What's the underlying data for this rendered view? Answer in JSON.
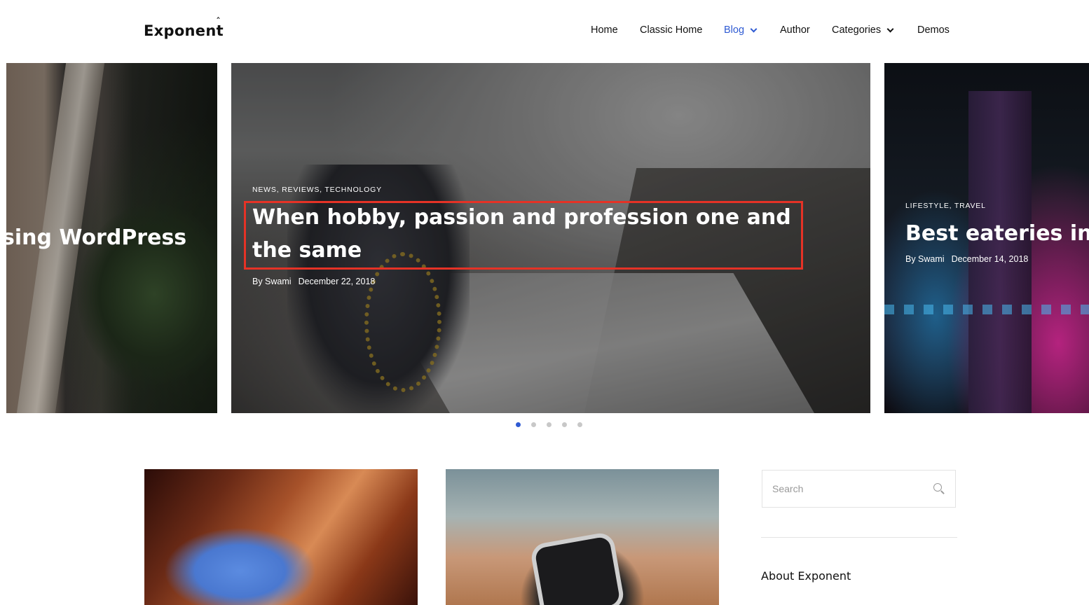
{
  "header": {
    "logo": "Exponent",
    "logo_mark": "ˆ",
    "nav": [
      {
        "label": "Home",
        "active": false,
        "dropdown": false
      },
      {
        "label": "Classic Home",
        "active": false,
        "dropdown": false
      },
      {
        "label": "Blog",
        "active": true,
        "dropdown": true
      },
      {
        "label": "Author",
        "active": false,
        "dropdown": false
      },
      {
        "label": "Categories",
        "active": false,
        "dropdown": true
      },
      {
        "label": "Demos",
        "active": false,
        "dropdown": false
      }
    ]
  },
  "slider": {
    "left": {
      "title": "sing WordPress"
    },
    "main": {
      "categories": "NEWS, REVIEWS, TECHNOLOGY",
      "title": "When hobby, passion and profession one and the same",
      "author": "By Swami",
      "date": "December 22, 2018"
    },
    "right": {
      "categories": "LIFESTYLE, TRAVEL",
      "title": "Best eateries in M",
      "author": "By Swami",
      "date": "December 14, 2018"
    },
    "dots": {
      "count": 5,
      "active_index": 0
    }
  },
  "sidebar": {
    "search_placeholder": "Search",
    "about_title": "About Exponent"
  },
  "colors": {
    "accent": "#2f5bd3",
    "highlight": "#e53226"
  }
}
